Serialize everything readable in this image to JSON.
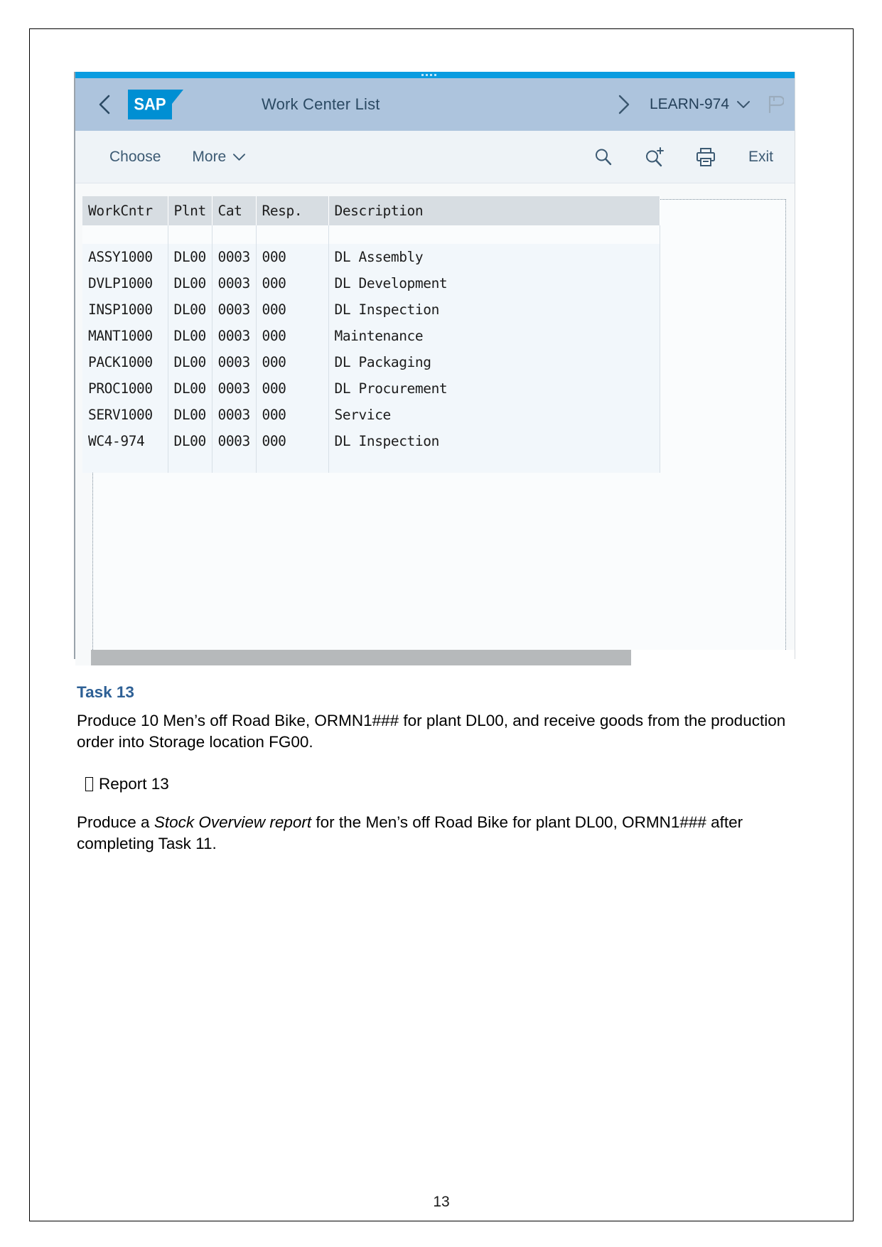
{
  "document": {
    "page_number": "13",
    "task": {
      "heading": "Task 13",
      "paragraph": "Produce 10 Men’s off Road Bike, ORMN1### for plant DL00, and receive goods from the production order into Storage location FG00."
    },
    "report": {
      "bullet_glyph": "missing-glyph-box",
      "label": "Report 13",
      "paragraph_before_italic": "Produce a ",
      "italic_text": "Stock Overview report",
      "paragraph_after_italic": " for the Men’s off Road Bike for plant DL00, ORMN1### after completing Task 11."
    }
  },
  "sap_app": {
    "shellbar": {
      "back_icon": "chevron-left-icon",
      "logo_text": "SAP",
      "title": "Work Center List",
      "forward_icon": "chevron-right-icon",
      "user": "LEARN-974",
      "user_chevron": "chevron-down-icon",
      "flag_icon": "flag-icon"
    },
    "toolbar": {
      "choose_label": "Choose",
      "more_label": "More",
      "more_chevron": "chevron-down-icon",
      "search_icon": "search-icon",
      "search_plus_icon": "search-plus-icon",
      "print_icon": "printer-icon",
      "exit_label": "Exit"
    },
    "grid": {
      "columns": [
        "WorkCntr",
        "Plnt",
        "Cat",
        "Resp.",
        "Description"
      ],
      "rows": [
        [
          "ASSY1000",
          "DL00",
          "0003",
          "000",
          "DL Assembly"
        ],
        [
          "DVLP1000",
          "DL00",
          "0003",
          "000",
          "DL Development"
        ],
        [
          "INSP1000",
          "DL00",
          "0003",
          "000",
          "DL Inspection"
        ],
        [
          "MANT1000",
          "DL00",
          "0003",
          "000",
          "Maintenance"
        ],
        [
          "PACK1000",
          "DL00",
          "0003",
          "000",
          "DL Packaging"
        ],
        [
          "PROC1000",
          "DL00",
          "0003",
          "000",
          "DL Procurement"
        ],
        [
          "SERV1000",
          "DL00",
          "0003",
          "000",
          "Service"
        ],
        [
          "WC4-974",
          "DL00",
          "0003",
          "000",
          "DL Inspection"
        ]
      ]
    },
    "scrollbar": {
      "orientation": "horizontal"
    }
  },
  "colors": {
    "accent_blue": "#0a9ce0",
    "shellbar_blue": "#adc4dd",
    "sap_logo_blue": "#008fd3",
    "heading_blue": "#2e6095",
    "grid_header_grey": "#d7dde2",
    "grid_row_blue": "#f2f7fb"
  }
}
